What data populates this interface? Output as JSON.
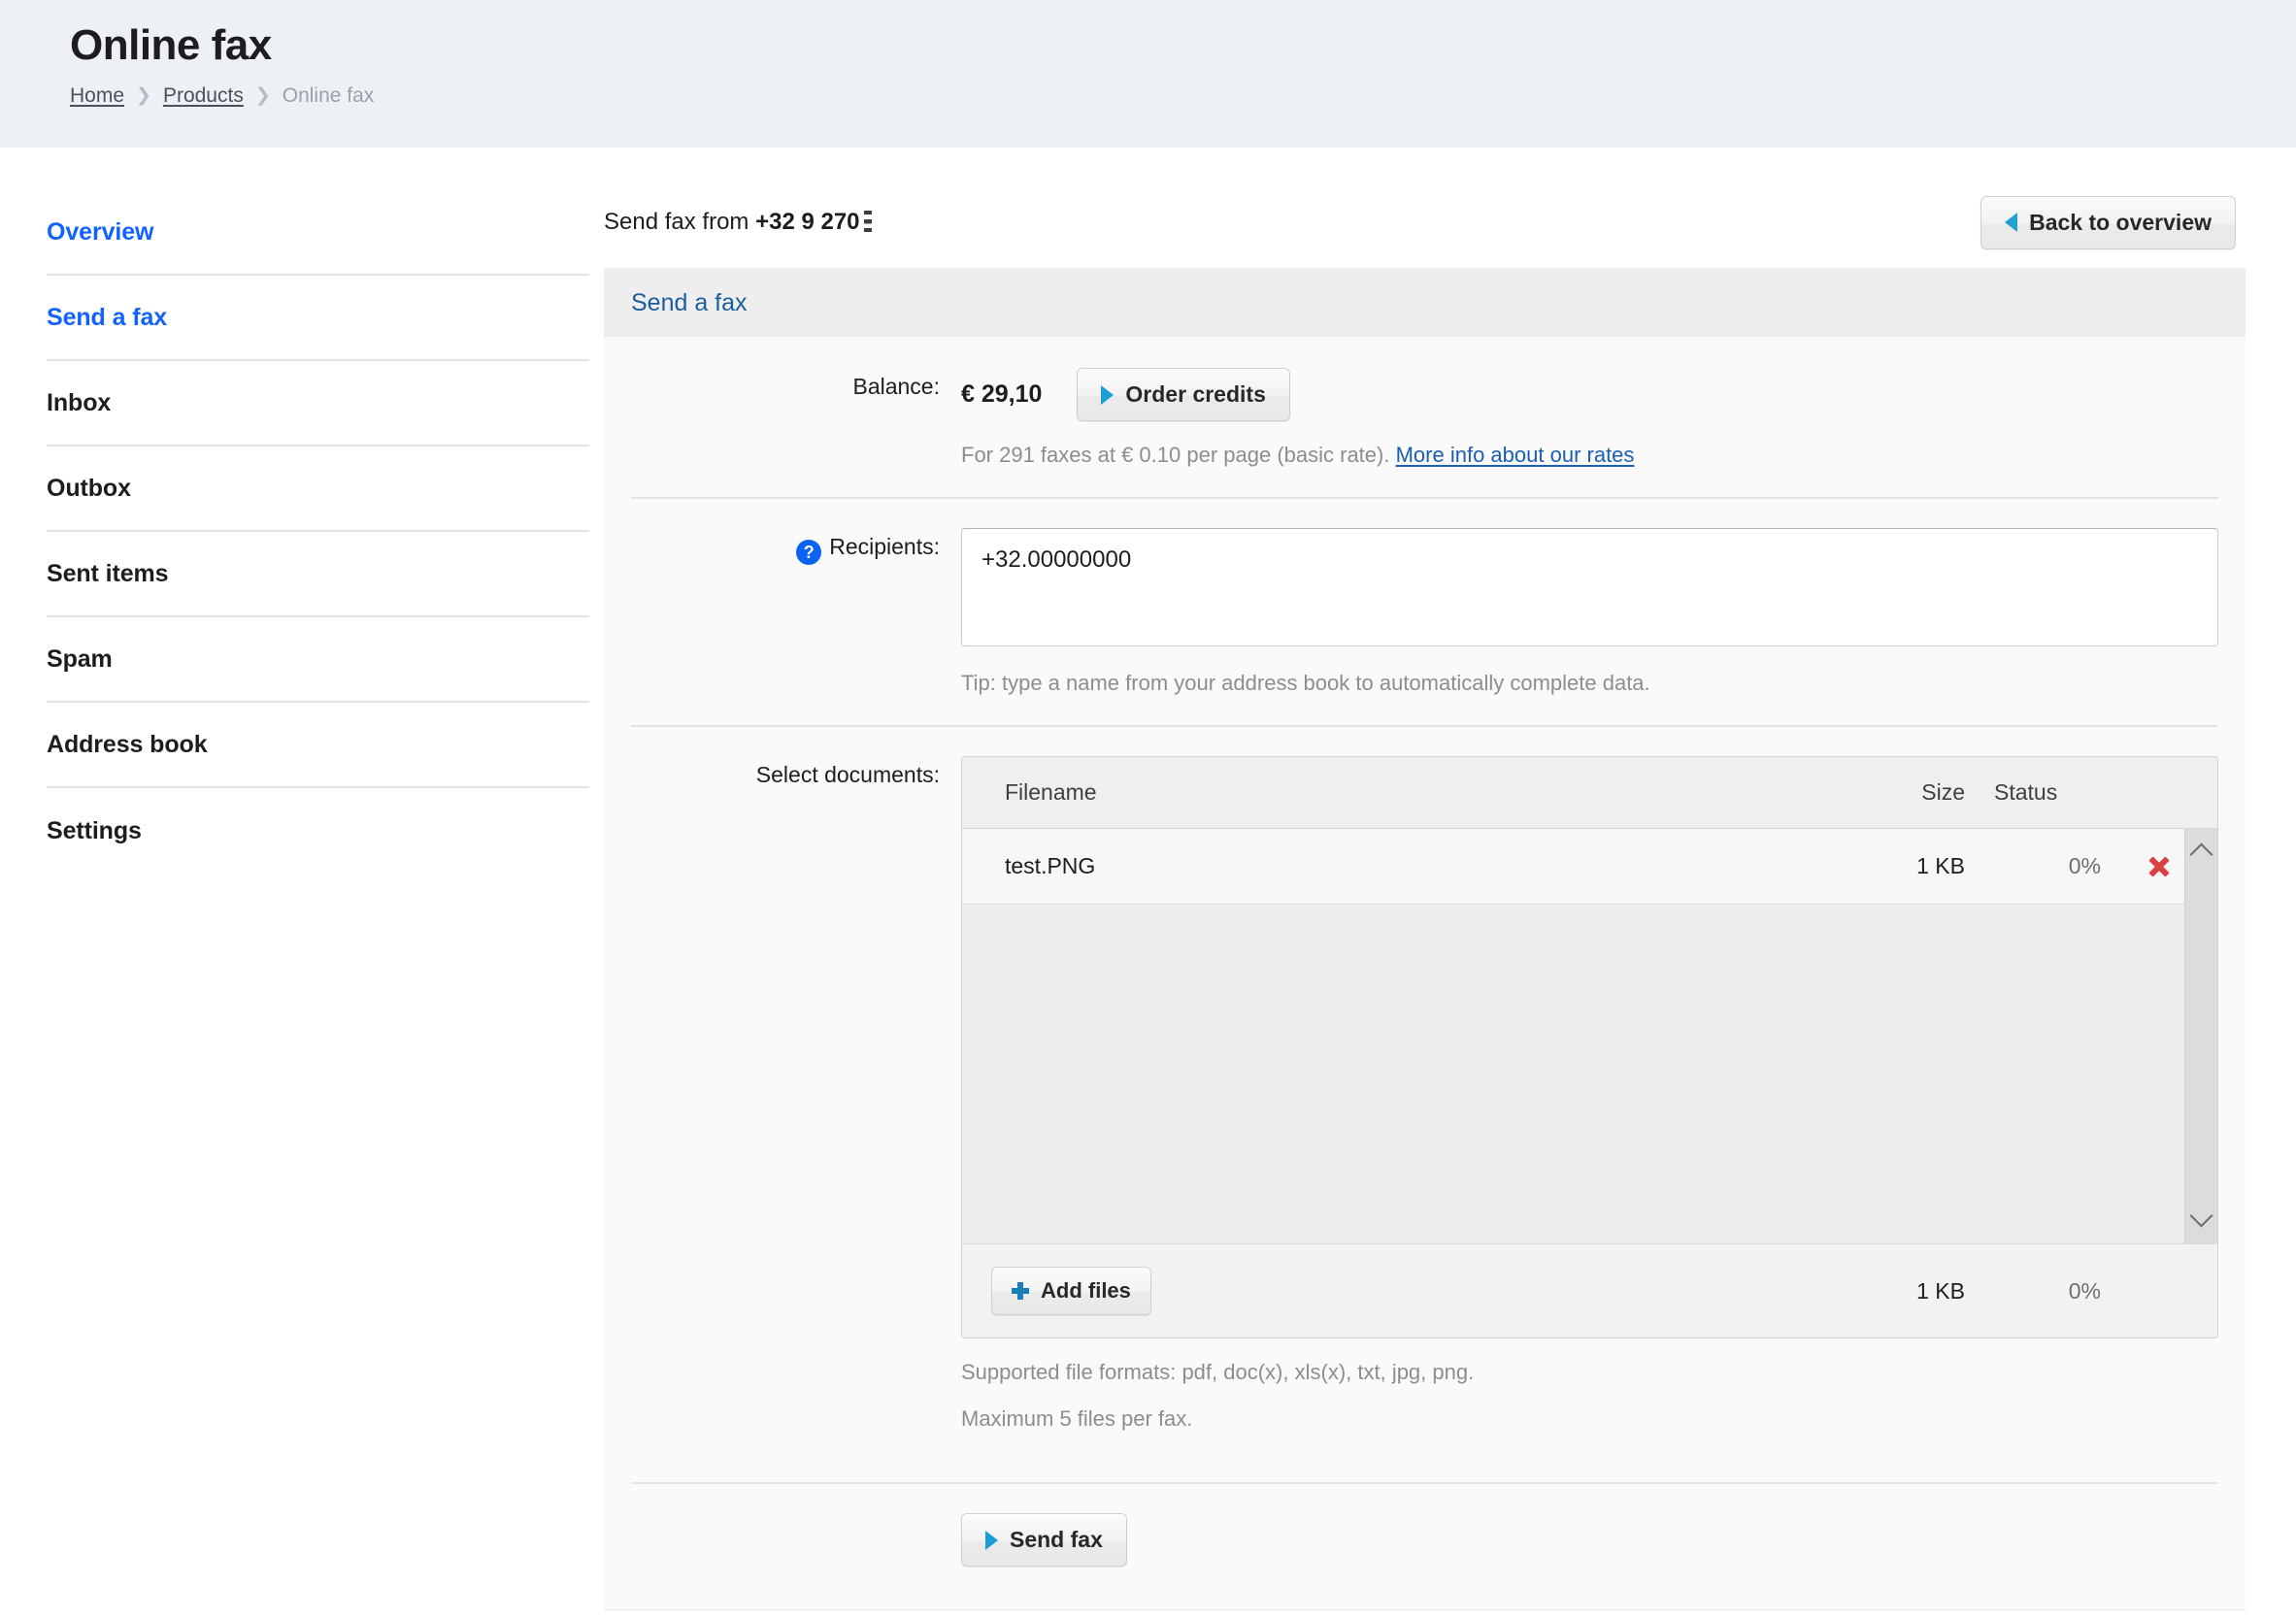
{
  "header": {
    "title": "Online fax",
    "breadcrumb": [
      {
        "label": "Home",
        "link": true
      },
      {
        "label": "Products",
        "link": true
      },
      {
        "label": "Online fax",
        "link": false
      }
    ],
    "separator": "❯"
  },
  "sidebar": {
    "items": [
      {
        "label": "Overview",
        "active": true
      },
      {
        "label": "Send a fax",
        "active": true
      },
      {
        "label": "Inbox",
        "active": false
      },
      {
        "label": "Outbox",
        "active": false
      },
      {
        "label": "Sent items",
        "active": false
      },
      {
        "label": "Spam",
        "active": false
      },
      {
        "label": "Address book",
        "active": false
      },
      {
        "label": "Settings",
        "active": false
      }
    ]
  },
  "main": {
    "send_from_prefix": "Send fax from",
    "send_from_number": "+32 9 270",
    "back_button": "Back to overview",
    "panel_title": "Send a fax"
  },
  "balance": {
    "label": "Balance:",
    "amount": "€ 29,10",
    "order_credits_button": "Order credits",
    "note_text": "For 291 faxes at € 0.10 per page (basic rate).",
    "note_link": "More info about our rates"
  },
  "recipients": {
    "label": "Recipients:",
    "help_glyph": "?",
    "value": "+32.00000000",
    "placeholder": "",
    "tip": "Tip: type a name from your address book to automatically complete data."
  },
  "documents": {
    "label": "Select documents:",
    "columns": {
      "filename": "Filename",
      "size": "Size",
      "status": "Status"
    },
    "rows": [
      {
        "filename": "test.PNG",
        "size": "1 KB",
        "status": "0%",
        "remove_icon": "remove-file-icon"
      }
    ],
    "footer": {
      "add_files_button": "Add files",
      "total_size": "1 KB",
      "total_status": "0%"
    },
    "notes": [
      "Supported file formats: pdf, doc(x), xls(x), txt, jpg, png.",
      "Maximum 5 files per fax."
    ]
  },
  "submit": {
    "send_fax_button": "Send fax"
  },
  "colors": {
    "accent_blue": "#1162ff",
    "panel_title_blue": "#1b5e9e",
    "link_blue": "#1a5fb4",
    "arrow_cyan": "#1b9ed6",
    "danger_red": "#d94040",
    "header_bg": "#edf1f5"
  }
}
